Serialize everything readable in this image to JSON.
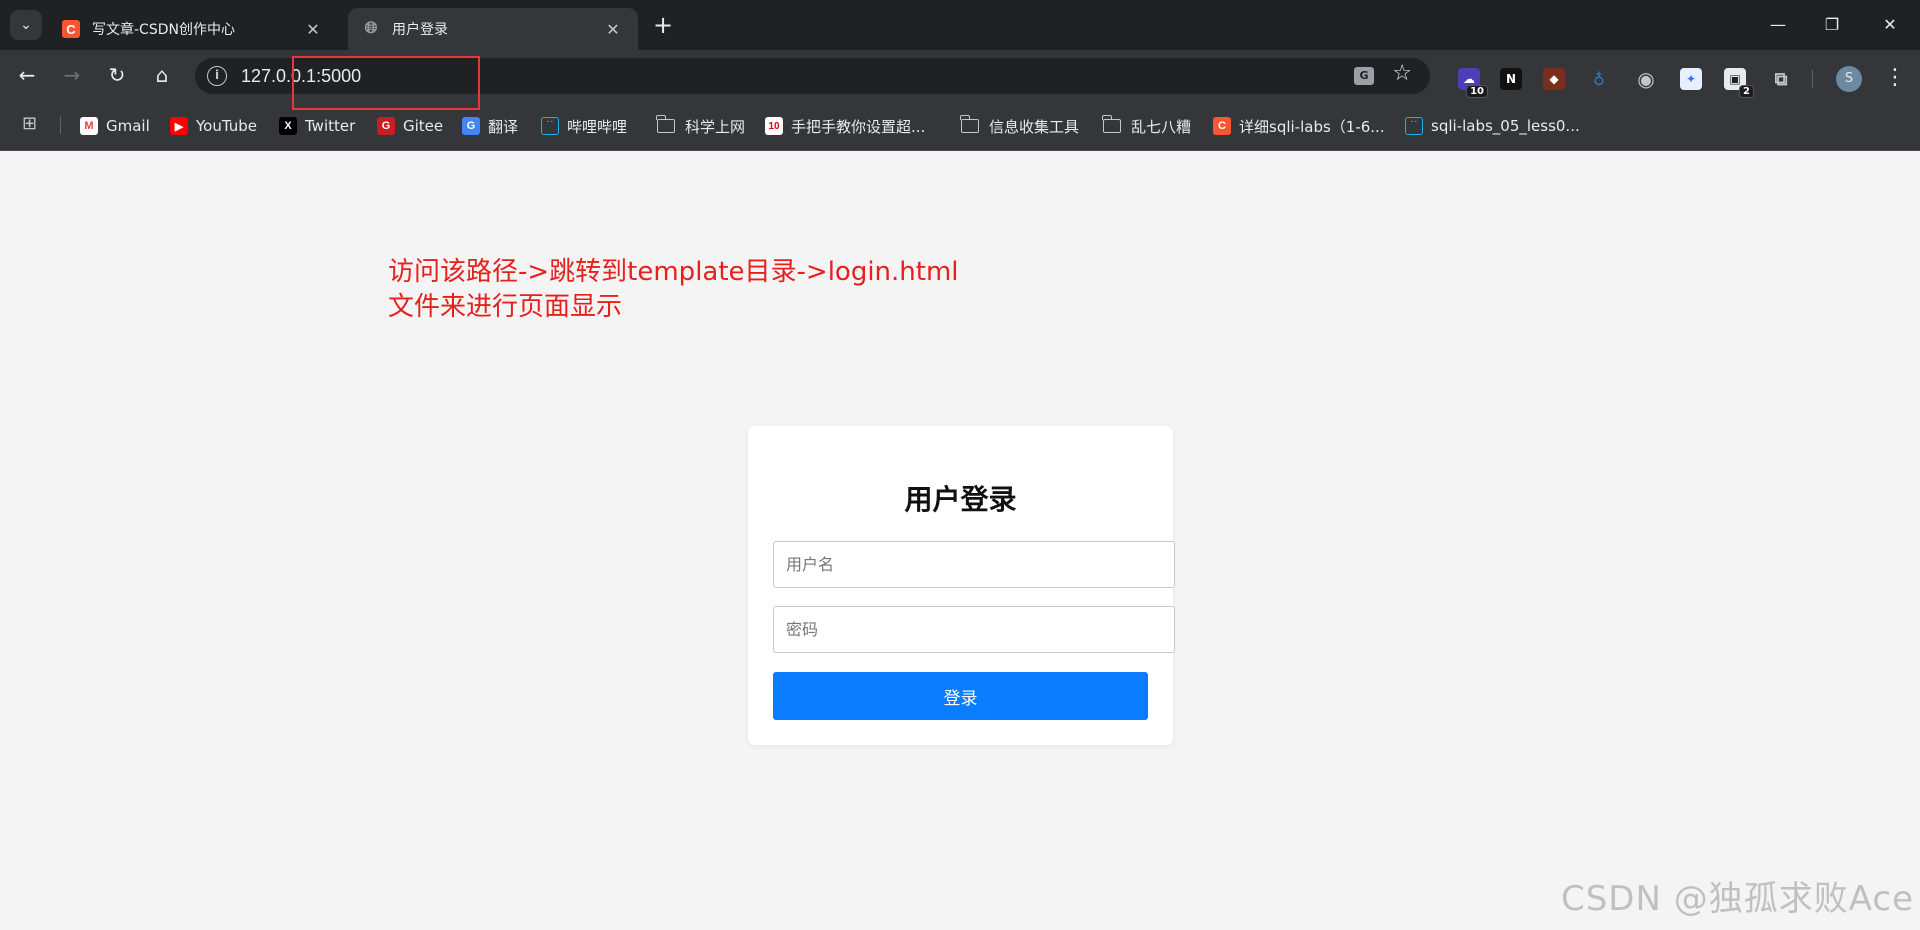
{
  "browser": {
    "tabs": [
      {
        "title": "写文章-CSDN创作中心",
        "favicon": "C",
        "active": false
      },
      {
        "title": "用户登录",
        "favicon": "globe-icon",
        "active": true
      }
    ],
    "address": "127.0.0.1:5000",
    "extension_badges": {
      "first": "10",
      "second": "2"
    },
    "profile_initial": "S",
    "bookmarks": [
      {
        "label": "Gmail",
        "icon": "M"
      },
      {
        "label": "YouTube",
        "icon": "▶"
      },
      {
        "label": "Twitter",
        "icon": "X"
      },
      {
        "label": "Gitee",
        "icon": "G"
      },
      {
        "label": "翻译",
        "icon": "G"
      },
      {
        "label": "哔哩哔哩",
        "icon": "bilibili"
      },
      {
        "label": "科学上网",
        "icon": "folder"
      },
      {
        "label": "手把手教你设置超...",
        "icon": "10"
      },
      {
        "label": "信息收集工具",
        "icon": "folder"
      },
      {
        "label": "乱七八糟",
        "icon": "folder"
      },
      {
        "label": "详细sqli-labs（1-6...",
        "icon": "C"
      },
      {
        "label": "sqli-labs_05_less0...",
        "icon": "bilibili"
      }
    ]
  },
  "annotation": {
    "line1": "访问该路径->跳转到template目录->login.html",
    "line2": "文件来进行页面显示",
    "color": "#e8201c"
  },
  "login": {
    "title": "用户登录",
    "username_placeholder": "用户名",
    "password_placeholder": "密码",
    "submit_label": "登录",
    "button_color": "#0a7cff"
  },
  "watermark": "CSDN @独孤求败Ace"
}
